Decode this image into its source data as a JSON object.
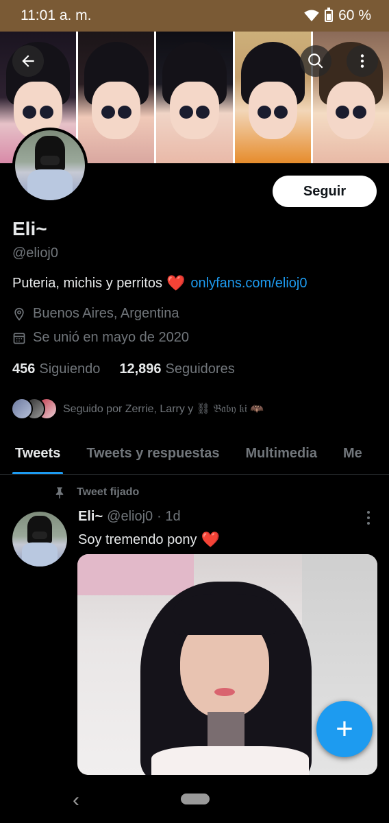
{
  "status_bar": {
    "time": "11:01 a. m.",
    "battery": "60 %"
  },
  "header": {
    "back_icon": "arrow-left-icon",
    "search_icon": "search-icon",
    "more_icon": "more-vertical-icon"
  },
  "profile": {
    "follow_label": "Seguir",
    "name": "Eli~",
    "handle": "@elioj0",
    "bio_text": "Puteria, michis y perritos",
    "bio_emoji": "❤️",
    "bio_link": "onlyfans.com/elioj0",
    "location": "Buenos Aires, Argentina",
    "joined": "Se unió en mayo de 2020",
    "following_count": "456",
    "following_label": "Siguiendo",
    "followers_count": "12,896",
    "followers_label": "Seguidores",
    "followed_by": "Seguido por Zerrie, Larry y ⛓ 𝔅𝔞𝔟𝔶 𝔨𝔦 🦇"
  },
  "tabs": [
    {
      "label": "Tweets",
      "active": true
    },
    {
      "label": "Tweets y respuestas",
      "active": false
    },
    {
      "label": "Multimedia",
      "active": false
    },
    {
      "label": "Me",
      "active": false
    }
  ],
  "tweet": {
    "pinned_label": "Tweet fijado",
    "author_name": "Eli~",
    "author_handle": "@elioj0",
    "time": "· 1d",
    "text": "Soy tremendo pony",
    "emoji": "❤️"
  },
  "fab": {
    "label": "+"
  },
  "nav": {
    "back": "‹"
  },
  "colors": {
    "accent": "#1d9bf0",
    "status_bar": "#7a5a35",
    "muted": "#71767b",
    "heart": "#f91880"
  }
}
